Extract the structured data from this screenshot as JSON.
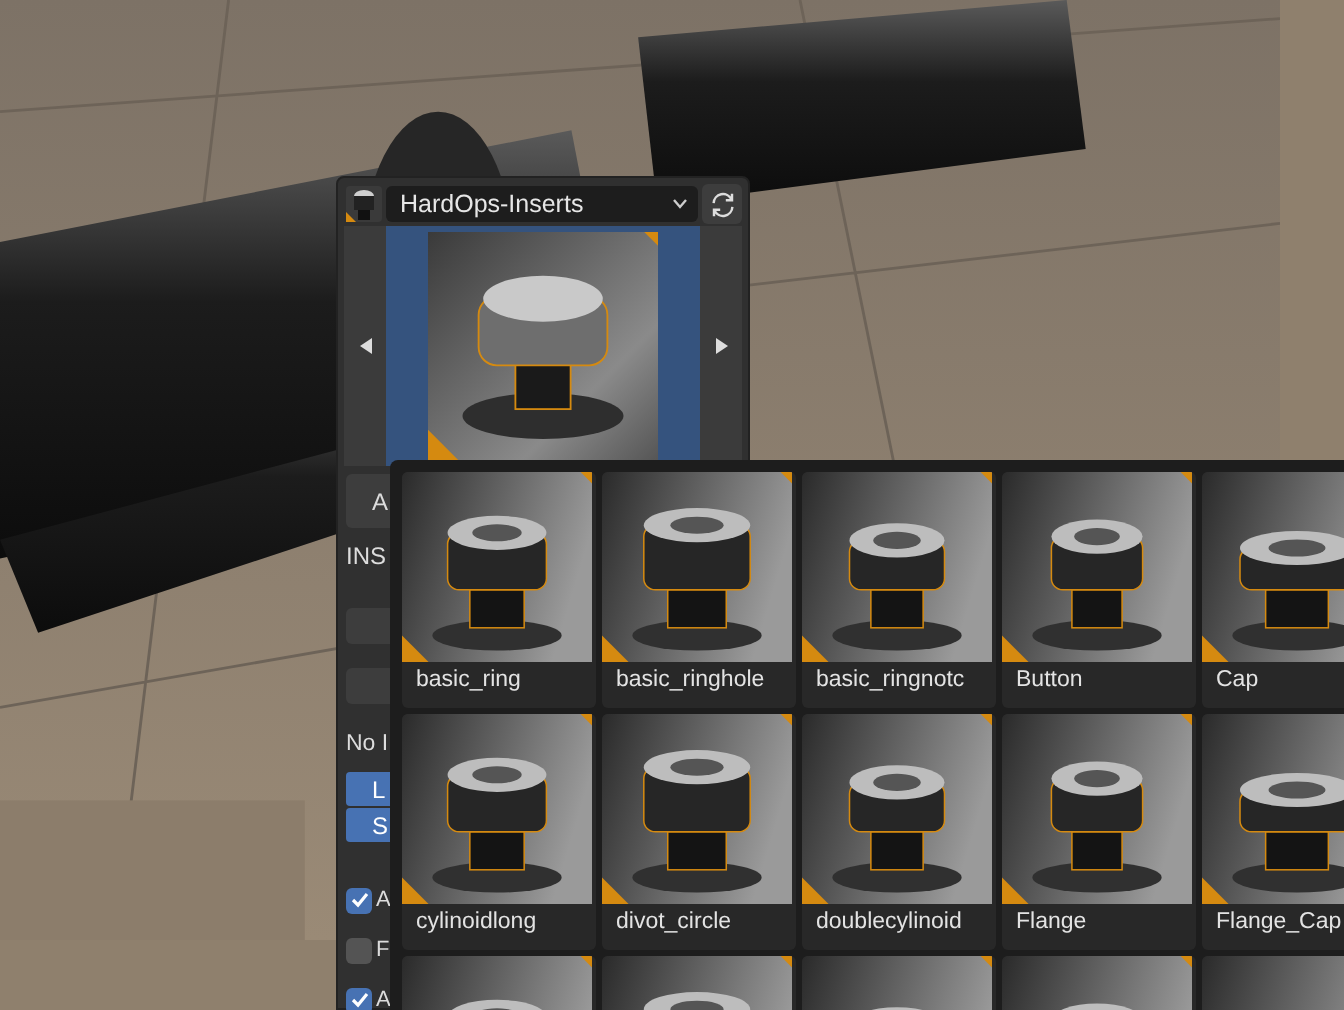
{
  "panel": {
    "library": "HardOps-Inserts",
    "top_button": "A",
    "section_label": "INS",
    "message": "No I",
    "toggles": [
      {
        "label": "L",
        "on": true
      },
      {
        "label": "S",
        "on": true
      }
    ],
    "checkboxes": [
      {
        "label": "A",
        "checked": true
      },
      {
        "label": "F",
        "checked": false
      },
      {
        "label": "A",
        "checked": true
      }
    ]
  },
  "popup": {
    "items": [
      {
        "kind": "asset",
        "label": "basic_ring"
      },
      {
        "kind": "asset",
        "label": "basic_ringhole"
      },
      {
        "kind": "asset",
        "label": "basic_ringnotc"
      },
      {
        "kind": "asset",
        "label": "Button"
      },
      {
        "kind": "asset",
        "label": "Cap"
      },
      {
        "kind": "asset",
        "label": "cylinoidlong"
      },
      {
        "kind": "asset",
        "label": "divot_circle"
      },
      {
        "kind": "asset",
        "label": "doublecylinoid"
      },
      {
        "kind": "asset",
        "label": "Flange"
      },
      {
        "kind": "asset",
        "label": "Flange_Cap"
      },
      {
        "kind": "picture"
      },
      {
        "kind": "picture"
      },
      {
        "kind": "picture"
      },
      {
        "kind": "picture"
      },
      {
        "kind": "picture"
      }
    ]
  }
}
